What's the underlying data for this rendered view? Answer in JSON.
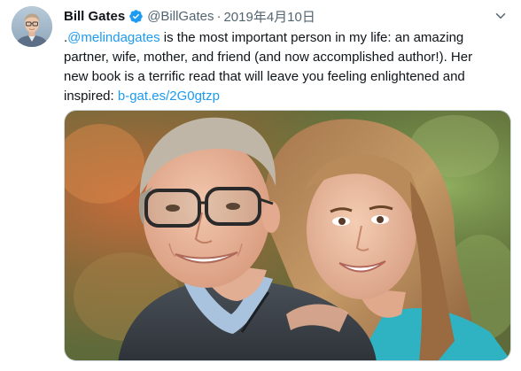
{
  "tweet": {
    "author": {
      "display_name": "Bill Gates",
      "handle": "@BillGates",
      "verified": true,
      "verified_icon": "verified-badge-icon",
      "avatar_icon": "avatar"
    },
    "separator": "·",
    "date": "2019年4月10日",
    "text": {
      "line1_prefix": ".",
      "mention": "@melindagates",
      "line1_rest": " is the most important person in my life: an amazing",
      "line2": "partner, wife, mother, and friend (and now accomplished author!). Her",
      "line3": "new book is a terrific read that will leave you feeling enlightened and",
      "line4_prefix": "inspired: ",
      "link": "b-gat.es/2G0gtzp"
    },
    "media": {
      "type": "photo"
    },
    "colors": {
      "link": "#1d9bf0",
      "text": "#0f1419",
      "secondary": "#536471",
      "verified": "#1d9bf0"
    }
  }
}
